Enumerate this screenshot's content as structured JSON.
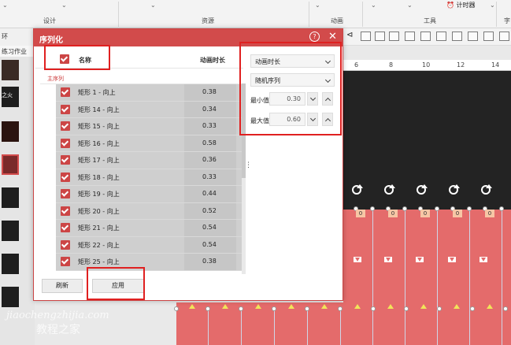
{
  "ribbon": {
    "groups": [
      "设计",
      "资源",
      "动画",
      "工具"
    ],
    "group_partial": "字",
    "timer_label": "计时器"
  },
  "left_panel": {
    "header_text": "环",
    "tab_label": "练习作业",
    "thumb_text": "之火"
  },
  "ruler": {
    "ticks": [
      "6",
      "8",
      "10",
      "12",
      "14"
    ]
  },
  "slide": {
    "zero_label": "0"
  },
  "dialog": {
    "title": "序列化",
    "help_glyph": "?",
    "close_glyph": "✕",
    "list_header": {
      "name": "名称",
      "duration": "动画时长"
    },
    "group_label": "主序列",
    "rows": [
      {
        "name": "矩形 1 - 向上",
        "value": "0.38"
      },
      {
        "name": "矩形 14 - 向上",
        "value": "0.34"
      },
      {
        "name": "矩形 15 - 向上",
        "value": "0.33"
      },
      {
        "name": "矩形 16 - 向上",
        "value": "0.58"
      },
      {
        "name": "矩形 17 - 向上",
        "value": "0.36"
      },
      {
        "name": "矩形 18 - 向上",
        "value": "0.33"
      },
      {
        "name": "矩形 19 - 向上",
        "value": "0.44"
      },
      {
        "name": "矩形 20 - 向上",
        "value": "0.52"
      },
      {
        "name": "矩形 21 - 向上",
        "value": "0.54"
      },
      {
        "name": "矩形 22 - 向上",
        "value": "0.54"
      },
      {
        "name": "矩形 25 - 向上",
        "value": "0.38"
      }
    ],
    "splitter_glyph": "⋮",
    "right_panel": {
      "property_select": "动画时长",
      "mode_select": "随机序列",
      "min_label": "最小值",
      "min_value": "0.30",
      "max_label": "最大值",
      "max_value": "0.60"
    },
    "buttons": {
      "refresh": "刷新",
      "apply": "应用"
    }
  },
  "watermark": {
    "latin": "jiaochengzhijia.com",
    "cn": "教程之家"
  },
  "colors": {
    "accent": "#d24b4b",
    "highlight": "#e02020",
    "slide_dark": "#232323",
    "slide_red": "#e46b6b"
  }
}
